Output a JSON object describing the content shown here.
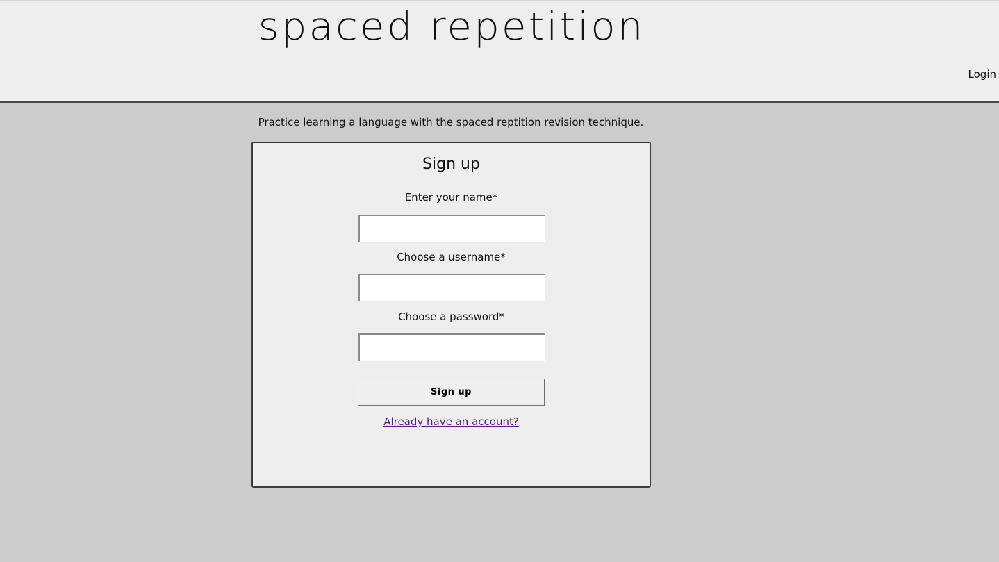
{
  "header": {
    "site_title": "spaced repetition",
    "login_label": "Login"
  },
  "main": {
    "tagline": "Practice learning a language with the spaced reptition revision technique."
  },
  "signup": {
    "title": "Sign up",
    "name_label": "Enter your name*",
    "name_value": "",
    "username_label": "Choose a username*",
    "username_value": "",
    "password_label": "Choose a password*",
    "password_value": "",
    "submit_label": "Sign up",
    "account_link": "Already have an account?"
  },
  "colors": {
    "page_background": "#cccccc",
    "header_background": "#eeeeee",
    "card_background": "#eeeeee",
    "link_visited": "#551a8b"
  }
}
